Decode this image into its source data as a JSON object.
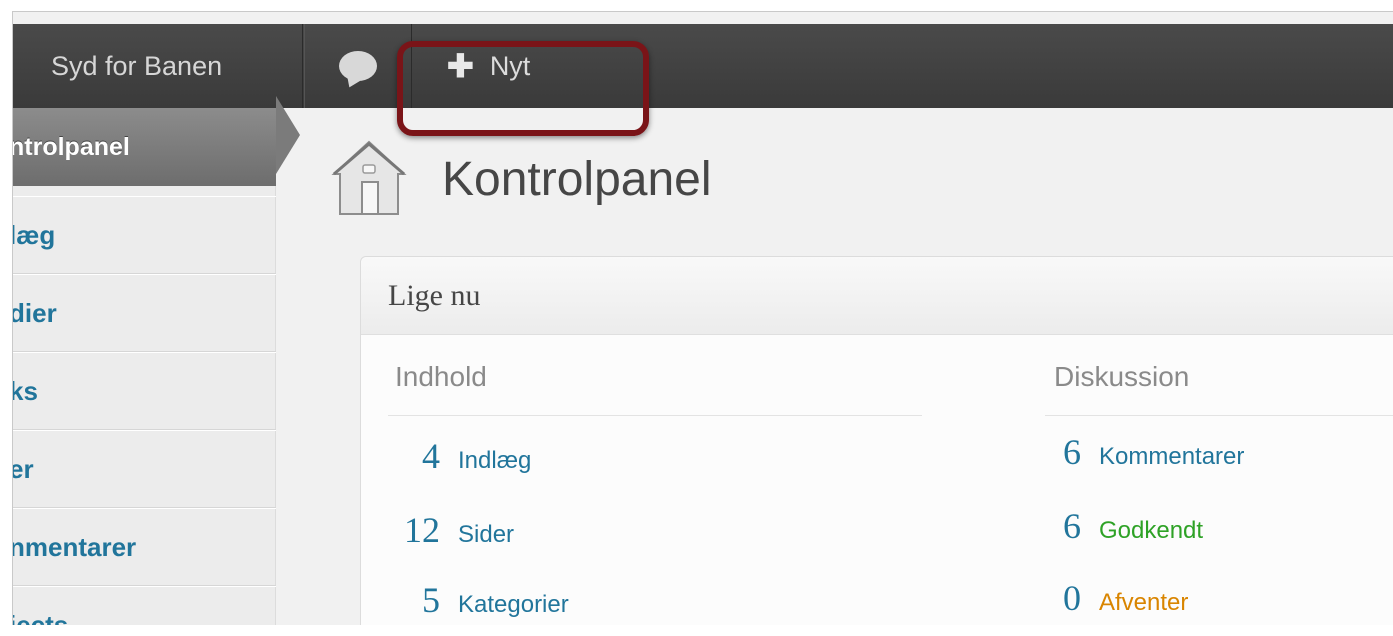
{
  "admin_bar": {
    "site_name": "Syd for Banen",
    "comments_icon": "comment-bubble-icon",
    "new_label": "Nyt",
    "new_icon": "plus-icon"
  },
  "sidebar": {
    "current": "ntrolpanel",
    "items": [
      {
        "label": "læg"
      },
      {
        "label": "dier"
      },
      {
        "label": "ks"
      },
      {
        "label": "er"
      },
      {
        "label": "nmentarer"
      },
      {
        "label": "jects"
      }
    ]
  },
  "main": {
    "page_title": "Kontrolpanel",
    "page_icon": "house-icon",
    "panel": {
      "title": "Lige nu",
      "content_header": "Indhold",
      "discussion_header": "Diskussion",
      "content_rows": [
        {
          "count": "4",
          "label": "Indlæg"
        },
        {
          "count": "12",
          "label": "Sider"
        },
        {
          "count": "5",
          "label": "Kategorier"
        }
      ],
      "discussion_rows": [
        {
          "count": "6",
          "label": "Kommentarer",
          "color": "#21759b"
        },
        {
          "count": "6",
          "label": "Godkendt",
          "color": "#2ea226"
        },
        {
          "count": "0",
          "label": "Afventer",
          "color": "#d98500"
        }
      ]
    }
  }
}
